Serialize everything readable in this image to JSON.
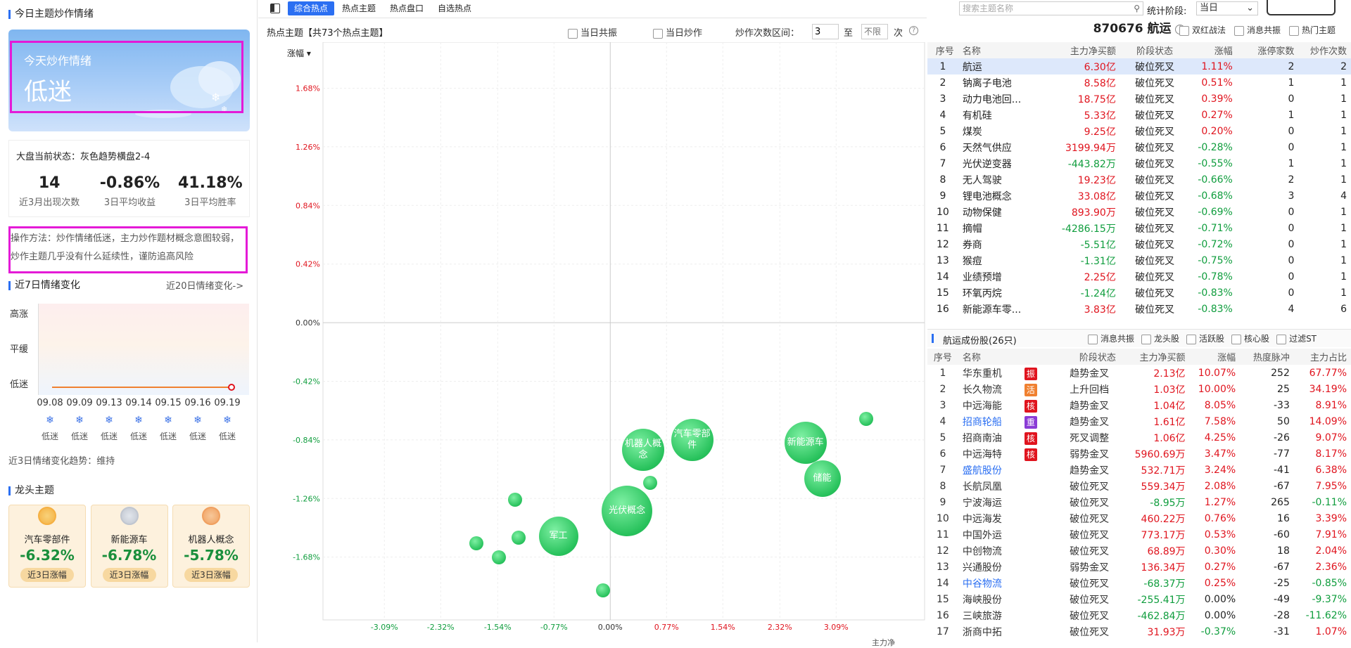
{
  "left": {
    "title": "今日主题炒作情绪",
    "mood_card": {
      "label": "今天炒作情绪",
      "value": "低迷"
    },
    "market_state": "大盘当前状态：灰色趋势横盘2-4",
    "stats": [
      {
        "value": "14",
        "label": "近3月出现次数"
      },
      {
        "value": "-0.86%",
        "label": "3日平均收益"
      },
      {
        "value": "41.18%",
        "label": "3日平均胜率"
      }
    ],
    "method": "操作方法：炒作情绪低迷，主力炒作题材概念意图较弱，炒作主题几乎没有什么延续性，谨防追高风险",
    "week_title": "近7日情绪变化",
    "week_link": "近20日情绪变化->",
    "levels": [
      "高涨",
      "平缓",
      "低迷"
    ],
    "days": [
      "09.08",
      "09.09",
      "09.13",
      "09.14",
      "09.15",
      "09.16",
      "09.19"
    ],
    "day_moods": [
      "低迷",
      "低迷",
      "低迷",
      "低迷",
      "低迷",
      "低迷",
      "低迷"
    ],
    "trend": "近3日情绪变化趋势：维持",
    "lead_title": "龙头主题",
    "leaders": [
      {
        "name": "汽车零部件",
        "value": "-6.32%",
        "tag": "近3日涨幅"
      },
      {
        "name": "新能源车",
        "value": "-6.78%",
        "tag": "近3日涨幅"
      },
      {
        "name": "机器人概念",
        "value": "-5.78%",
        "tag": "近3日涨幅"
      }
    ]
  },
  "mid": {
    "tabs": [
      "综合热点",
      "热点主题",
      "热点盘口",
      "自选热点"
    ],
    "chart_title": "热点主题【共73个热点主题】",
    "cb_resonance": "当日共振",
    "cb_hype": "当日炒作",
    "range_label": "炒作次数区间：",
    "range_from": "3",
    "range_to_word": "至",
    "range_to_placeholder": "不限",
    "range_unit": "次",
    "sort_label": "涨幅",
    "x_axis_end": "主力净"
  },
  "chart_data": {
    "type": "scatter",
    "y_ticks": [
      "1.68%",
      "1.26%",
      "0.84%",
      "0.42%",
      "0.00%",
      "-0.42%",
      "-0.84%",
      "-1.26%",
      "-1.68%"
    ],
    "x_ticks": [
      "-3.09%",
      "-2.32%",
      "-1.54%",
      "-0.77%",
      "0.00%",
      "0.77%",
      "1.54%",
      "2.32%",
      "3.09%"
    ],
    "points": [
      {
        "label": "机器人概念",
        "x": 0.45,
        "y": -0.91
      },
      {
        "label": "汽车零部件",
        "x": 1.12,
        "y": -0.84
      },
      {
        "label": "新能源车",
        "x": 2.67,
        "y": -0.86
      },
      {
        "label": "储能",
        "x": 2.9,
        "y": -1.12
      },
      {
        "label": "光伏概念",
        "x": 0.23,
        "y": -1.35
      },
      {
        "label": "军工",
        "x": -0.71,
        "y": -1.53
      },
      {
        "label": "",
        "x": 0.55,
        "y": -1.15
      },
      {
        "label": "",
        "x": -1.3,
        "y": -1.27
      },
      {
        "label": "",
        "x": -1.25,
        "y": -1.54
      },
      {
        "label": "",
        "x": -1.83,
        "y": -1.58
      },
      {
        "label": "",
        "x": -1.52,
        "y": -1.68
      },
      {
        "label": "",
        "x": -0.1,
        "y": -1.92
      },
      {
        "label": "",
        "x": 3.5,
        "y": -0.69
      }
    ]
  },
  "right": {
    "search_placeholder": "搜索主题名称",
    "period_label": "统计阶段:",
    "period_value": "当日",
    "stock_code": "870676",
    "stock_name": "航运",
    "filters": [
      "双红战法",
      "消息共振",
      "热门主题"
    ],
    "topic_headers": [
      "序号",
      "名称",
      "主力净买额",
      "阶段状态",
      "涨幅",
      "涨停家数",
      "炒作次数"
    ],
    "topics": [
      [
        "1",
        "航运",
        "6.30亿",
        "破位死叉",
        "1.11%",
        "2",
        "2"
      ],
      [
        "2",
        "钠离子电池",
        "8.58亿",
        "破位死叉",
        "0.51%",
        "1",
        "1"
      ],
      [
        "3",
        "动力电池回...",
        "18.75亿",
        "破位死叉",
        "0.39%",
        "0",
        "1"
      ],
      [
        "4",
        "有机硅",
        "5.33亿",
        "破位死叉",
        "0.27%",
        "1",
        "1"
      ],
      [
        "5",
        "煤炭",
        "9.25亿",
        "破位死叉",
        "0.20%",
        "0",
        "1"
      ],
      [
        "6",
        "天然气供应",
        "3199.94万",
        "破位死叉",
        "-0.28%",
        "0",
        "1"
      ],
      [
        "7",
        "光伏逆变器",
        "-443.82万",
        "破位死叉",
        "-0.55%",
        "1",
        "1"
      ],
      [
        "8",
        "无人驾驶",
        "19.23亿",
        "破位死叉",
        "-0.66%",
        "2",
        "1"
      ],
      [
        "9",
        "锂电池概念",
        "33.08亿",
        "破位死叉",
        "-0.68%",
        "3",
        "4"
      ],
      [
        "10",
        "动物保健",
        "893.90万",
        "破位死叉",
        "-0.69%",
        "0",
        "1"
      ],
      [
        "11",
        "摘帽",
        "-4286.15万",
        "破位死叉",
        "-0.71%",
        "0",
        "1"
      ],
      [
        "12",
        "券商",
        "-5.51亿",
        "破位死叉",
        "-0.72%",
        "0",
        "1"
      ],
      [
        "13",
        "猴痘",
        "-1.31亿",
        "破位死叉",
        "-0.75%",
        "0",
        "1"
      ],
      [
        "14",
        "业绩预增",
        "2.25亿",
        "破位死叉",
        "-0.78%",
        "0",
        "1"
      ],
      [
        "15",
        "环氧丙烷",
        "-1.24亿",
        "破位死叉",
        "-0.83%",
        "0",
        "1"
      ],
      [
        "16",
        "新能源车零...",
        "3.83亿",
        "破位死叉",
        "-0.83%",
        "4",
        "6"
      ]
    ],
    "comp_title": "航运成份股(26只)",
    "comp_filters": [
      "消息共振",
      "龙头股",
      "活跃股",
      "核心股",
      "过滤ST"
    ],
    "stock_headers": [
      "序号",
      "名称",
      "阶段状态",
      "主力净买额",
      "涨幅",
      "热度脉冲",
      "主力占比"
    ],
    "stocks": [
      [
        "1",
        "华东重机",
        "振",
        "趋势金叉",
        "2.13亿",
        "10.07%",
        "252",
        "67.77%"
      ],
      [
        "2",
        "长久物流",
        "活",
        "上升回档",
        "1.03亿",
        "10.00%",
        "25",
        "34.19%"
      ],
      [
        "3",
        "中远海能",
        "核",
        "趋势金叉",
        "1.04亿",
        "8.05%",
        "-33",
        "8.91%"
      ],
      [
        "4",
        "招商轮船",
        "重",
        "趋势金叉",
        "1.61亿",
        "7.58%",
        "50",
        "14.09%"
      ],
      [
        "5",
        "招商南油",
        "核",
        "死叉调整",
        "1.06亿",
        "4.25%",
        "-26",
        "9.07%"
      ],
      [
        "6",
        "中远海特",
        "核",
        "弱势金叉",
        "5960.69万",
        "3.47%",
        "-77",
        "8.17%"
      ],
      [
        "7",
        "盛航股份",
        "",
        "趋势金叉",
        "532.71万",
        "3.24%",
        "-41",
        "6.38%"
      ],
      [
        "8",
        "长航凤凰",
        "",
        "破位死叉",
        "559.34万",
        "2.08%",
        "-67",
        "7.95%"
      ],
      [
        "9",
        "宁波海运",
        "",
        "破位死叉",
        "-8.95万",
        "1.27%",
        "265",
        "-0.11%"
      ],
      [
        "10",
        "中远海发",
        "",
        "破位死叉",
        "460.22万",
        "0.76%",
        "16",
        "3.39%"
      ],
      [
        "11",
        "中国外运",
        "",
        "破位死叉",
        "773.17万",
        "0.53%",
        "-60",
        "7.91%"
      ],
      [
        "12",
        "中创物流",
        "",
        "破位死叉",
        "68.89万",
        "0.30%",
        "18",
        "2.04%"
      ],
      [
        "13",
        "兴通股份",
        "",
        "弱势金叉",
        "136.34万",
        "0.27%",
        "-67",
        "2.36%"
      ],
      [
        "14",
        "中谷物流",
        "",
        "破位死叉",
        "-68.37万",
        "0.25%",
        "-25",
        "-0.85%"
      ],
      [
        "15",
        "海峡股份",
        "",
        "破位死叉",
        "-255.41万",
        "0.00%",
        "-49",
        "-9.37%"
      ],
      [
        "16",
        "三峡旅游",
        "",
        "破位死叉",
        "-462.84万",
        "0.00%",
        "-28",
        "-11.62%"
      ],
      [
        "17",
        "浙商中拓",
        "",
        "破位死叉",
        "31.93万",
        "-0.37%",
        "-31",
        "1.07%"
      ]
    ],
    "link_rows": [
      4,
      7,
      14
    ]
  }
}
